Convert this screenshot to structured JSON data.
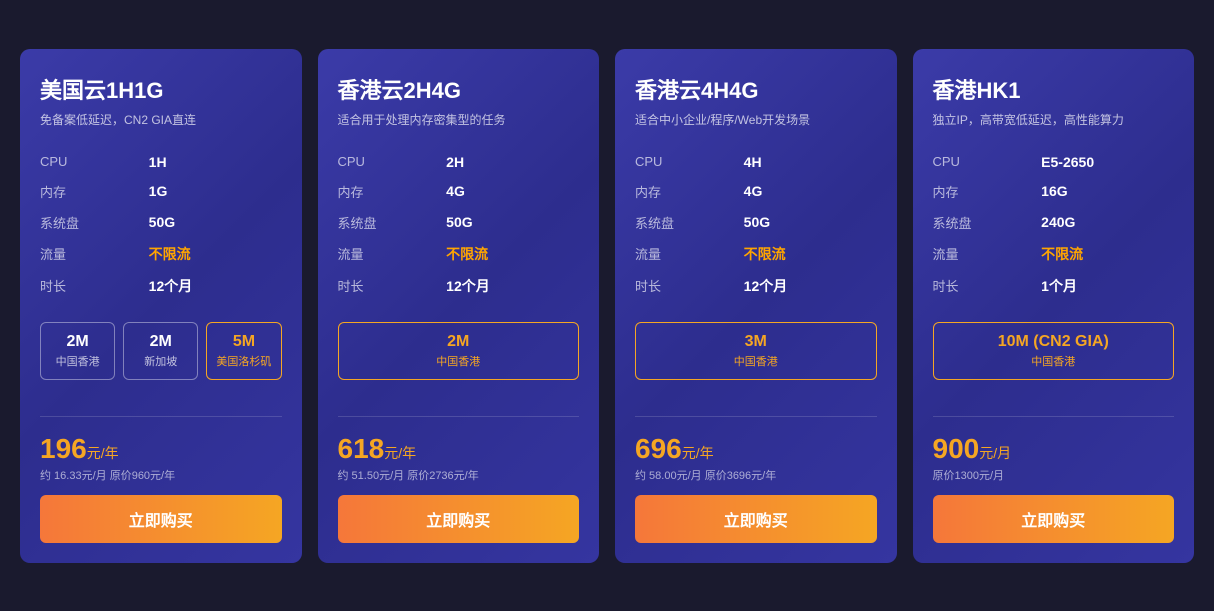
{
  "cards": [
    {
      "id": "card-1",
      "title": "美国云1H1G",
      "subtitle": "免备案低延迟，CN2 GIA直连",
      "specs": [
        {
          "label": "CPU",
          "value": "1H",
          "highlight": false
        },
        {
          "label": "内存",
          "value": "1G",
          "highlight": false
        },
        {
          "label": "系统盘",
          "value": "50G",
          "highlight": false
        },
        {
          "label": "流量",
          "value": "不限流",
          "highlight": true
        },
        {
          "label": "时长",
          "value": "12个月",
          "highlight": false
        }
      ],
      "bandwidth_options": [
        {
          "speed": "2M",
          "location": "中国香港",
          "active": false
        },
        {
          "speed": "2M",
          "location": "新加坡",
          "active": false
        },
        {
          "speed": "5M",
          "location": "美国洛杉矶",
          "active": true
        }
      ],
      "price": "196",
      "price_unit": "元/年",
      "price_sub": "约 16.33元/月  原价960元/年",
      "buy_label": "立即购买"
    },
    {
      "id": "card-2",
      "title": "香港云2H4G",
      "subtitle": "适合用于处理内存密集型的任务",
      "specs": [
        {
          "label": "CPU",
          "value": "2H",
          "highlight": false
        },
        {
          "label": "内存",
          "value": "4G",
          "highlight": false
        },
        {
          "label": "系统盘",
          "value": "50G",
          "highlight": false
        },
        {
          "label": "流量",
          "value": "不限流",
          "highlight": true
        },
        {
          "label": "时长",
          "value": "12个月",
          "highlight": false
        }
      ],
      "bandwidth_options": [
        {
          "speed": "2M",
          "location": "中国香港",
          "active": true
        }
      ],
      "price": "618",
      "price_unit": "元/年",
      "price_sub": "约 51.50元/月  原价2736元/年",
      "buy_label": "立即购买"
    },
    {
      "id": "card-3",
      "title": "香港云4H4G",
      "subtitle": "适合中小企业/程序/Web开发场景",
      "specs": [
        {
          "label": "CPU",
          "value": "4H",
          "highlight": false
        },
        {
          "label": "内存",
          "value": "4G",
          "highlight": false
        },
        {
          "label": "系统盘",
          "value": "50G",
          "highlight": false
        },
        {
          "label": "流量",
          "value": "不限流",
          "highlight": true
        },
        {
          "label": "时长",
          "value": "12个月",
          "highlight": false
        }
      ],
      "bandwidth_options": [
        {
          "speed": "3M",
          "location": "中国香港",
          "active": true
        }
      ],
      "price": "696",
      "price_unit": "元/年",
      "price_sub": "约 58.00元/月  原价3696元/年",
      "buy_label": "立即购买"
    },
    {
      "id": "card-4",
      "title": "香港HK1",
      "subtitle": "独立IP，高带宽低延迟，高性能算力",
      "specs": [
        {
          "label": "CPU",
          "value": "E5-2650",
          "highlight": false
        },
        {
          "label": "内存",
          "value": "16G",
          "highlight": false
        },
        {
          "label": "系统盘",
          "value": "240G",
          "highlight": false
        },
        {
          "label": "流量",
          "value": "不限流",
          "highlight": true
        },
        {
          "label": "时长",
          "value": "1个月",
          "highlight": false
        }
      ],
      "bandwidth_options": [
        {
          "speed": "10M (CN2 GIA)",
          "location": "中国香港",
          "active": true
        }
      ],
      "price": "900",
      "price_unit": "元/月",
      "price_sub": "原价1300元/月",
      "buy_label": "立即购买"
    }
  ]
}
